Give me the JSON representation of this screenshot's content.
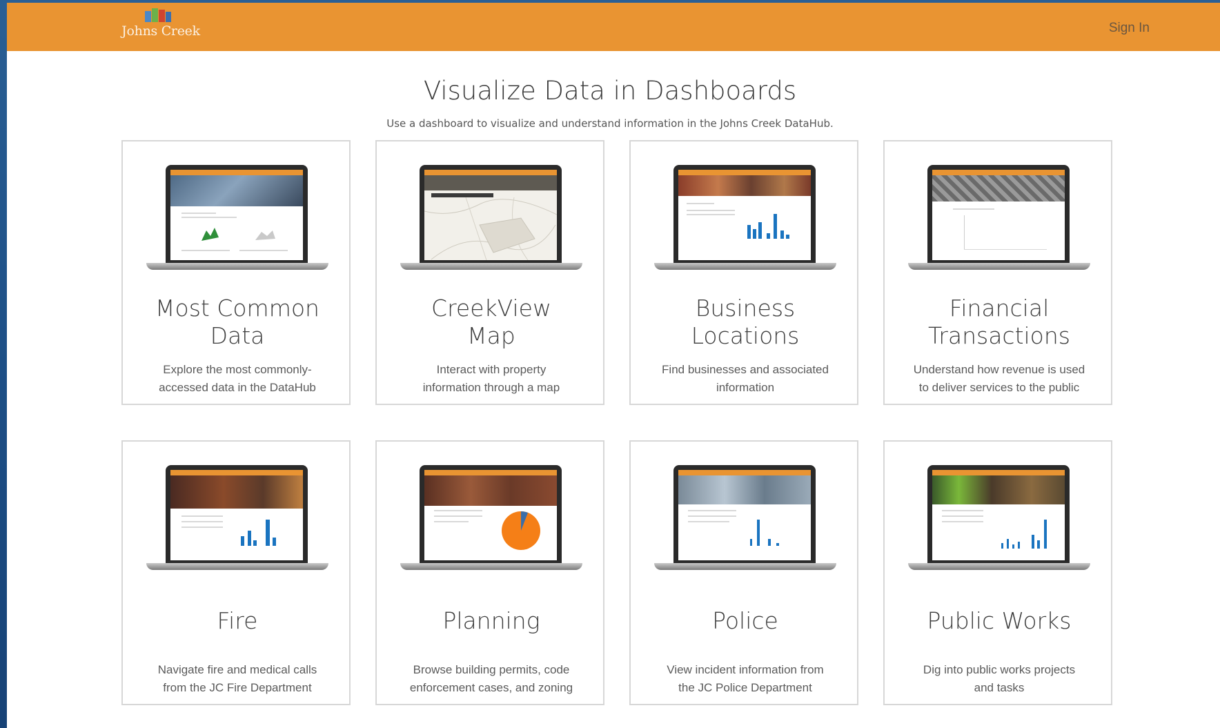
{
  "header": {
    "logo_text": "Johns Creek",
    "sign_in": "Sign In",
    "colors": {
      "bar": "#e99432"
    }
  },
  "main": {
    "title": "Visualize Data in Dashboards",
    "subtitle": "Use a dashboard to visualize and understand information in the Johns Creek DataHub."
  },
  "cards": [
    {
      "title_line1": "Most Common",
      "title_line2": "Data",
      "desc_line1": "Explore the most commonly-",
      "desc_line2": "accessed data in the DataHub"
    },
    {
      "title_line1": "CreekView",
      "title_line2": "Map",
      "desc_line1": "Interact with property",
      "desc_line2": "information through a map"
    },
    {
      "title_line1": "Business",
      "title_line2": "Locations",
      "desc_line1": "Find businesses and associated",
      "desc_line2": "information"
    },
    {
      "title_line1": "Financial",
      "title_line2": "Transactions",
      "desc_line1": "Understand how revenue is used",
      "desc_line2": "to deliver services to the public"
    },
    {
      "title_line1": "Fire",
      "title_line2": "",
      "desc_line1": "Navigate fire and medical calls",
      "desc_line2": "from the JC Fire Department"
    },
    {
      "title_line1": "Planning",
      "title_line2": "",
      "desc_line1": "Browse building permits, code",
      "desc_line2": "enforcement cases, and zoning"
    },
    {
      "title_line1": "Police",
      "title_line2": "",
      "desc_line1": "View incident information from",
      "desc_line2": "the JC Police Department"
    },
    {
      "title_line1": "Public Works",
      "title_line2": "",
      "desc_line1": "Dig into public works projects",
      "desc_line2": "and tasks"
    }
  ]
}
